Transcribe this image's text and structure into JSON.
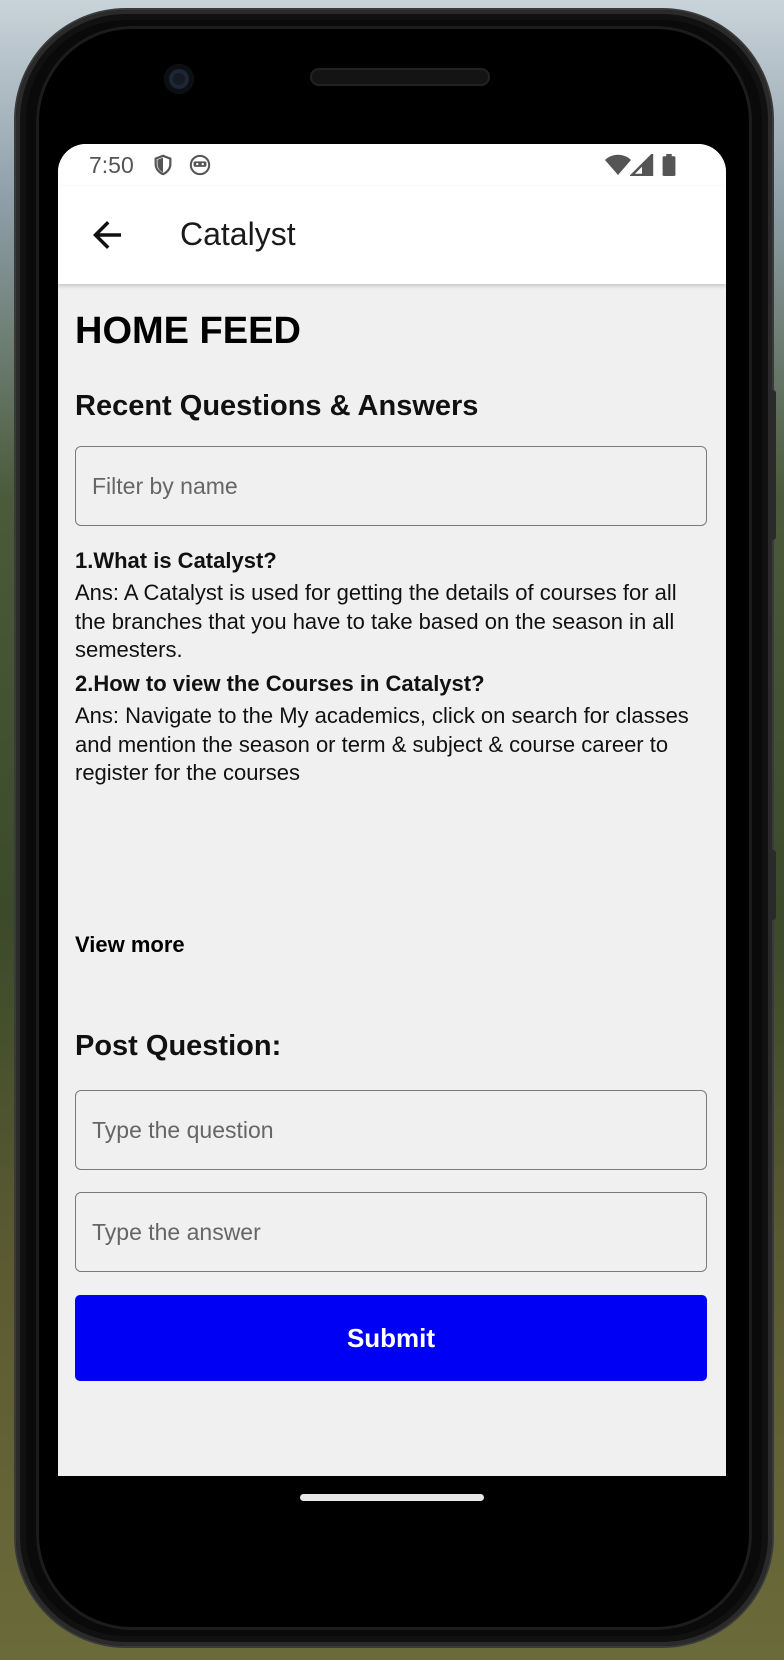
{
  "status_bar": {
    "time": "7:50"
  },
  "app_bar": {
    "title": "Catalyst"
  },
  "home": {
    "heading": "HOME FEED",
    "recent_heading": "Recent Questions & Answers",
    "filter_placeholder": "Filter by name",
    "qa_items": [
      {
        "question": "1.What is Catalyst?",
        "answer": "Ans: A Catalyst is used for getting the details of courses for all the branches that you have to take based on the season in all semesters."
      },
      {
        "question": "2.How to view the Courses in Catalyst?",
        "answer": "Ans: Navigate to the My academics, click on search for classes and mention the season or term & subject & course career to register for the courses"
      }
    ],
    "view_more": "View more"
  },
  "post": {
    "heading": "Post Question:",
    "question_placeholder": "Type the question",
    "answer_placeholder": "Type the answer",
    "submit_label": "Submit"
  },
  "colors": {
    "accent": "#0000f5",
    "screen_bg": "#f0f0f0"
  }
}
